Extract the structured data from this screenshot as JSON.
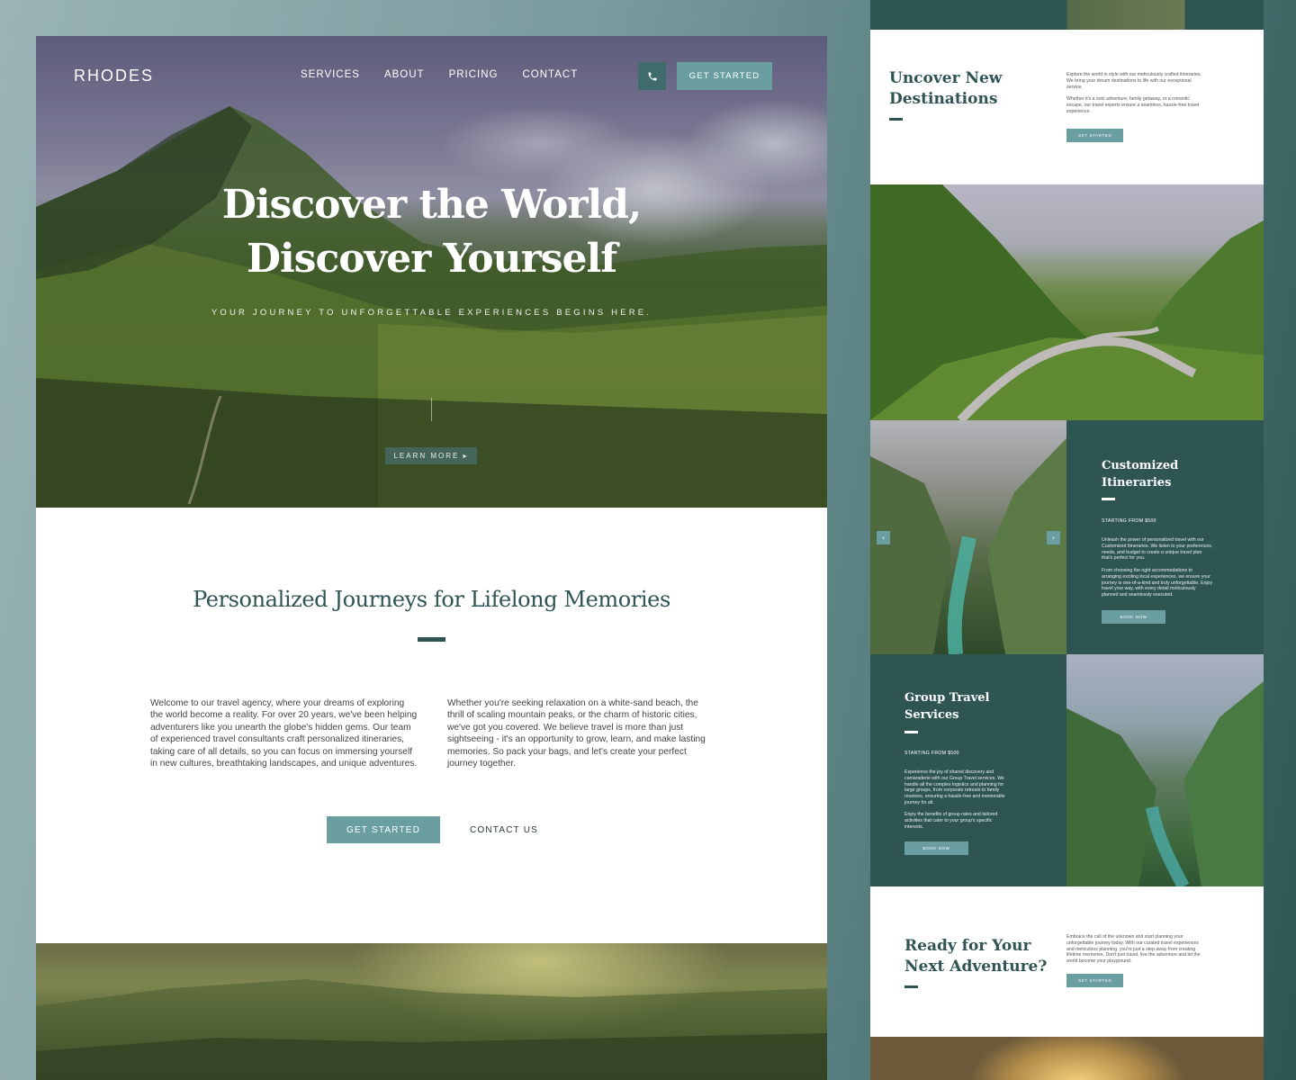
{
  "main": {
    "logo": "RHODES",
    "nav": [
      "SERVICES",
      "ABOUT",
      "PRICING",
      "CONTACT"
    ],
    "header_cta": "GET STARTED",
    "hero_title_line1": "Discover the World,",
    "hero_title_line2": "Discover Yourself",
    "hero_subtitle": "YOUR JOURNEY TO UNFORGETTABLE EXPERIENCES BEGINS HERE.",
    "learn_more": "LEARN MORE ▸",
    "intro_title": "Personalized Journeys for Lifelong Memories",
    "intro_left": "Welcome to our travel agency, where your dreams of exploring the world become a reality. For over 20 years, we've been helping adventurers like you unearth the globe's hidden gems. Our team of experienced travel consultants craft personalized itineraries, taking care of all details, so you can focus on immersing yourself in new cultures, breathtaking landscapes, and unique adventures.",
    "intro_right": "Whether you're seeking relaxation on a white-sand beach, the thrill of scaling mountain peaks, or the charm of historic cities, we've got you covered. We believe travel is more than just sightseeing - it's an opportunity to grow, learn, and make lasting memories. So pack your bags, and let's create your perfect journey together.",
    "cta_primary": "GET STARTED",
    "cta_secondary": "CONTACT US"
  },
  "side": {
    "destinations": {
      "title_line1": "Uncover New",
      "title_line2": "Destinations",
      "text1": "Explore the world in style with our meticulously crafted itineraries. We bring your dream destinations to life with our exceptional service.",
      "text2": "Whether it's a solo adventure, family getaway, or a romantic escape, our travel experts ensure a seamless, hassle-free travel experience.",
      "button": "GET STARTED"
    },
    "itineraries": {
      "title_line1": "Customized",
      "title_line2": "Itineraries",
      "price": "STARTING FROM $500",
      "text1": "Unleash the power of personalized travel with our Customized Itineraries. We listen to your preferences, needs, and budget to create a unique travel plan that's perfect for you.",
      "text2": "From choosing the right accommodations to arranging exciting local experiences, we ensure your journey is one-of-a-kind and truly unforgettable. Enjoy travel your way, with every detail meticulously planned and seamlessly executed.",
      "button": "BOOK NOW",
      "prev": "‹",
      "next": "›"
    },
    "group": {
      "title_line1": "Group Travel",
      "title_line2": "Services",
      "price": "STARTING FROM $500",
      "text1": "Experience the joy of shared discovery and camaraderie with our Group Travel services. We handle all the complex logistics and planning for large groups, from corporate retreats to family reunions, ensuring a hassle-free and memorable journey for all.",
      "text2": "Enjoy the benefits of group rates and tailored activities that cater to your group's specific interests.",
      "button": "BOOK NOW"
    },
    "ready": {
      "title_line1": "Ready for Your",
      "title_line2": "Next Adventure?",
      "text": "Embrace the call of the unknown and start planning your unforgettable journey today. With our curated travel experiences and meticulous planning, you're just a step away from creating lifetime memories. Don't just travel, live the adventure and let the world become your playground.",
      "button": "GET STARTED"
    }
  },
  "colors": {
    "accent_teal": "#6a9ea0",
    "dark_green": "#2f5553",
    "heading": "#2f5453"
  }
}
